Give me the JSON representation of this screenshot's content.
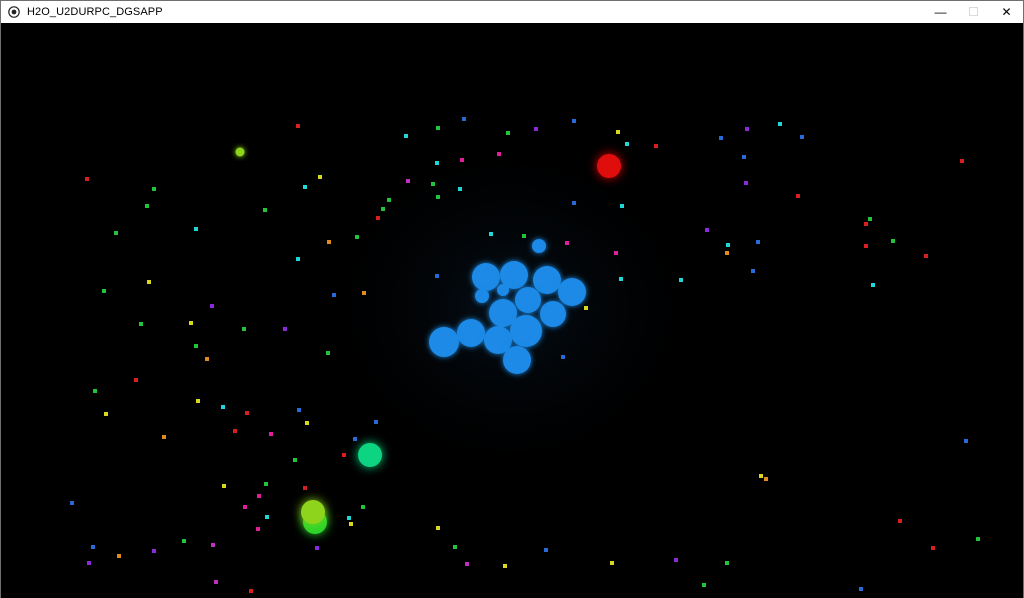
{
  "window": {
    "title": "H2O_U2DURPC_DGSAPP",
    "icon": "app-logo-icon",
    "controls": [
      {
        "name": "minimize-button",
        "glyph": "—",
        "icon": "minimize-icon",
        "enabled": true
      },
      {
        "name": "maximize-button",
        "glyph": "☐",
        "icon": "maximize-icon",
        "enabled": false
      },
      {
        "name": "close-button",
        "glyph": "✕",
        "icon": "close-icon",
        "enabled": true
      }
    ]
  },
  "game": {
    "background": "#000000",
    "player_color": "#1a8ae6",
    "enemy_colors": {
      "red": "#e01010",
      "teal": "#10d480",
      "lime": "#8fd41a",
      "green": "#2ad42a"
    }
  }
}
